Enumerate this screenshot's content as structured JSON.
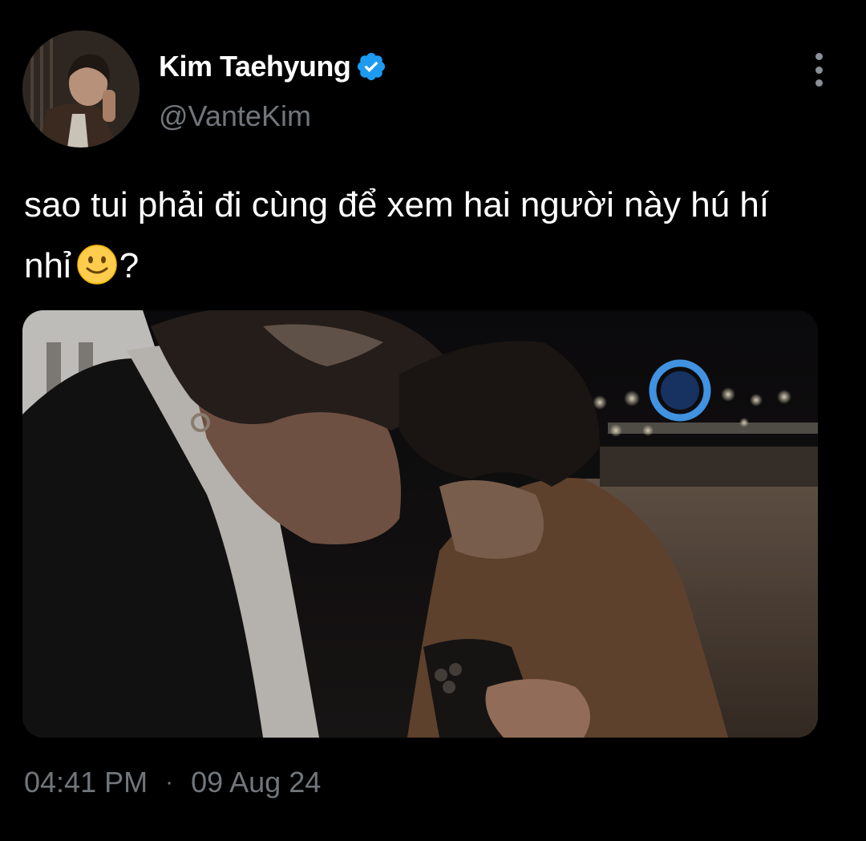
{
  "author": {
    "display_name": "Kim Taehyung",
    "handle": "@VanteKim",
    "verified": true,
    "avatar_icon": "profile-photo"
  },
  "tweet": {
    "text_line1": "sao tui phải đi cùng để xem hai người này hú hí",
    "text_line2_start": "nhỉ",
    "emoji_name": "slightly-smiling-face",
    "text_line2_end": "?"
  },
  "media": {
    "type": "photo"
  },
  "meta": {
    "time": "04:41 PM",
    "separator": "·",
    "date": "09 Aug 24"
  },
  "colors": {
    "background": "#000000",
    "text": "#ffffff",
    "secondary": "#71767b",
    "verified_blue": "#1d9bf0"
  }
}
